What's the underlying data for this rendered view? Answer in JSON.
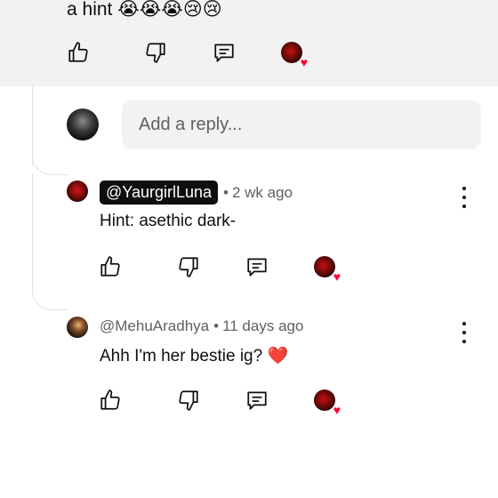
{
  "parent_comment": {
    "text_tail": "a hint",
    "emojis": "😭😭😭😢😢"
  },
  "reply_box": {
    "placeholder": "Add a reply..."
  },
  "replies": [
    {
      "handle": "@YaurgirlLuna",
      "time": "2 wk ago",
      "text": "Hint: asethic dark-",
      "creator_badge": true
    },
    {
      "handle": "@MehuAradhya",
      "time": "11 days ago",
      "text": "Ahh I'm her bestie ig?",
      "text_emoji": "❤️",
      "creator_badge": false
    }
  ],
  "separator": "•",
  "icons": {
    "like": "thumbs-up-icon",
    "dislike": "thumbs-down-icon",
    "reply": "comment-icon",
    "creator_heart": "heart-icon",
    "more": "more-vertical-icon"
  },
  "colors": {
    "heart": "#ff0033",
    "panel": "#f2f2f2",
    "badge": "#0f0f0f",
    "meta_text": "#606060"
  }
}
